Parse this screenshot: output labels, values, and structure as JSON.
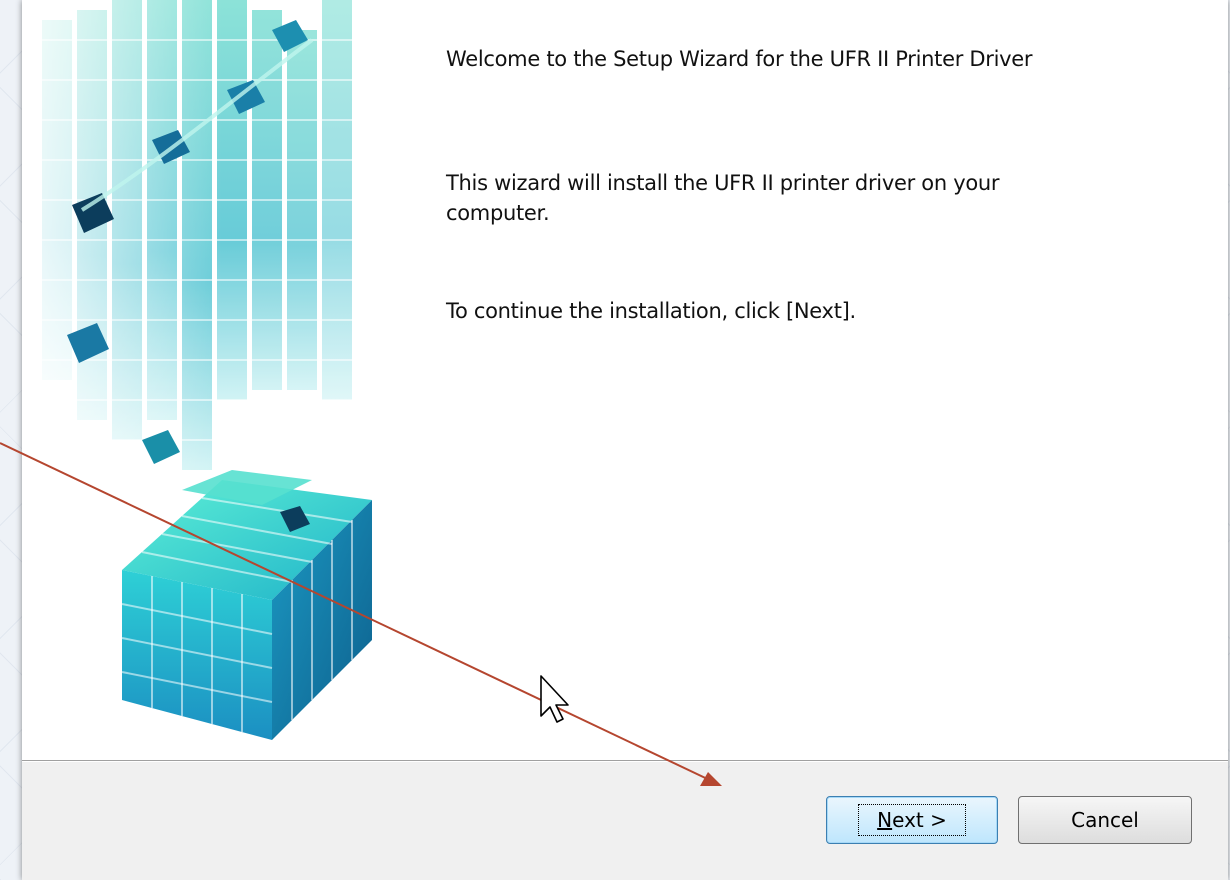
{
  "wizard": {
    "welcome_text": "Welcome to the Setup Wizard for the UFR II Printer Driver",
    "description_text": "This wizard will install the UFR II printer driver on your computer.",
    "instruction_text": "To continue the installation, click [Next].",
    "next_button": {
      "mnemonic": "N",
      "rest": "ext >"
    },
    "cancel_button": "Cancel"
  },
  "colors": {
    "annotation_arrow": "#b5462f",
    "cube_accent": "#2ec4c4",
    "cube_dark": "#0e6c8a"
  },
  "icons": [
    "mouse-cursor-icon"
  ]
}
